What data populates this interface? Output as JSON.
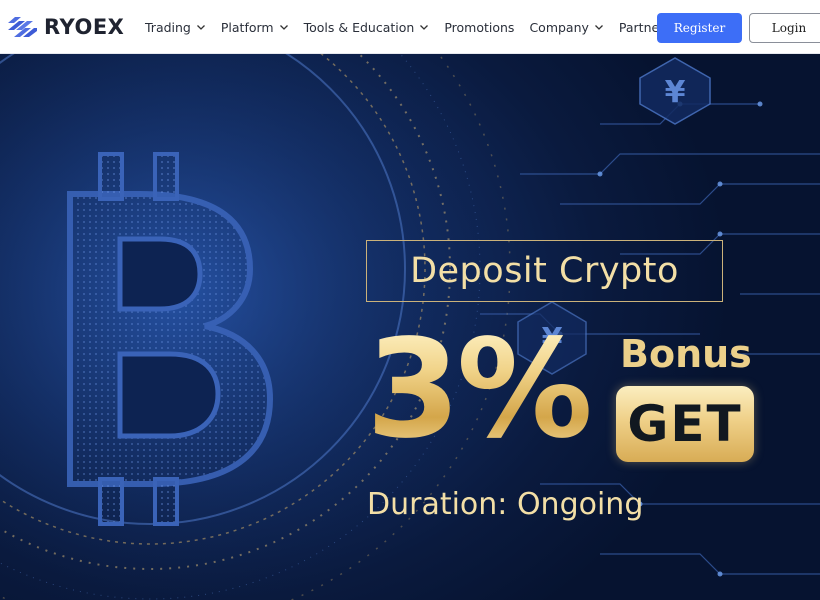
{
  "brand": {
    "name": "RYOEX",
    "logo_icon": "ryoex-logo-icon"
  },
  "nav": {
    "items": [
      {
        "label": "Trading",
        "has_dropdown": true
      },
      {
        "label": "Platform",
        "has_dropdown": true
      },
      {
        "label": "Tools & Education",
        "has_dropdown": true
      },
      {
        "label": "Promotions",
        "has_dropdown": false
      },
      {
        "label": "Company",
        "has_dropdown": true
      },
      {
        "label": "Partners",
        "has_dropdown": false
      }
    ]
  },
  "auth": {
    "register_label": "Register",
    "login_label": "Login"
  },
  "hero": {
    "headline": "Deposit Crypto",
    "percent": "3%",
    "bonus_label": "Bonus",
    "get_label": "GET",
    "duration": "Duration: Ongoing",
    "background_icon": "bitcoin-coin-icon",
    "currency_symbol": "¥"
  },
  "colors": {
    "accent_blue": "#3d6ef7",
    "gold": "#e8c77a",
    "hero_dark": "#0a1a3e"
  }
}
